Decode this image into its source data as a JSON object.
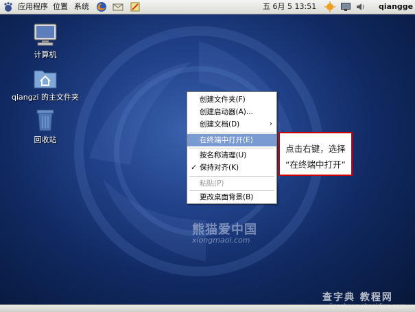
{
  "top_panel": {
    "menu_applications": "应用程序",
    "menu_places": "位置",
    "menu_system": "系统",
    "clock": "五 6月  5 13:51",
    "user": "qiangge"
  },
  "desktop": {
    "icons": [
      {
        "label": "计算机",
        "icon": "computer-icon"
      },
      {
        "label": "qiangzi 的主文件夹",
        "icon": "home-folder-icon"
      },
      {
        "label": "回收站",
        "icon": "trash-icon"
      }
    ]
  },
  "context_menu": {
    "items": [
      {
        "label": "创建文件夹(F)"
      },
      {
        "label": "创建启动器(A)..."
      },
      {
        "label": "创建文档(D)",
        "submenu": true
      },
      {
        "label": "在终端中打开(E)",
        "selected": true
      },
      {
        "label": "按名称清理(U)"
      },
      {
        "label": "保持对齐(K)",
        "checked": true
      },
      {
        "label": "粘贴(P)",
        "disabled": true
      },
      {
        "label": "更改桌面背景(B)"
      }
    ],
    "submenu_arrow": "›",
    "checkmark": "✓"
  },
  "callout": {
    "line1": "点击右键，选择",
    "line2": "“在终端中打开”",
    "border_color": "#d10000"
  },
  "watermarks": {
    "logo_text": "熊猫爱中国",
    "logo_url": "xiongmaoi.com",
    "site": "查字典 教程网",
    "site_url": "jiaocheng.chazidian.com"
  },
  "colors": {
    "desktop_bg": "#21428a",
    "menu_highlight": "#7a9ad2"
  }
}
